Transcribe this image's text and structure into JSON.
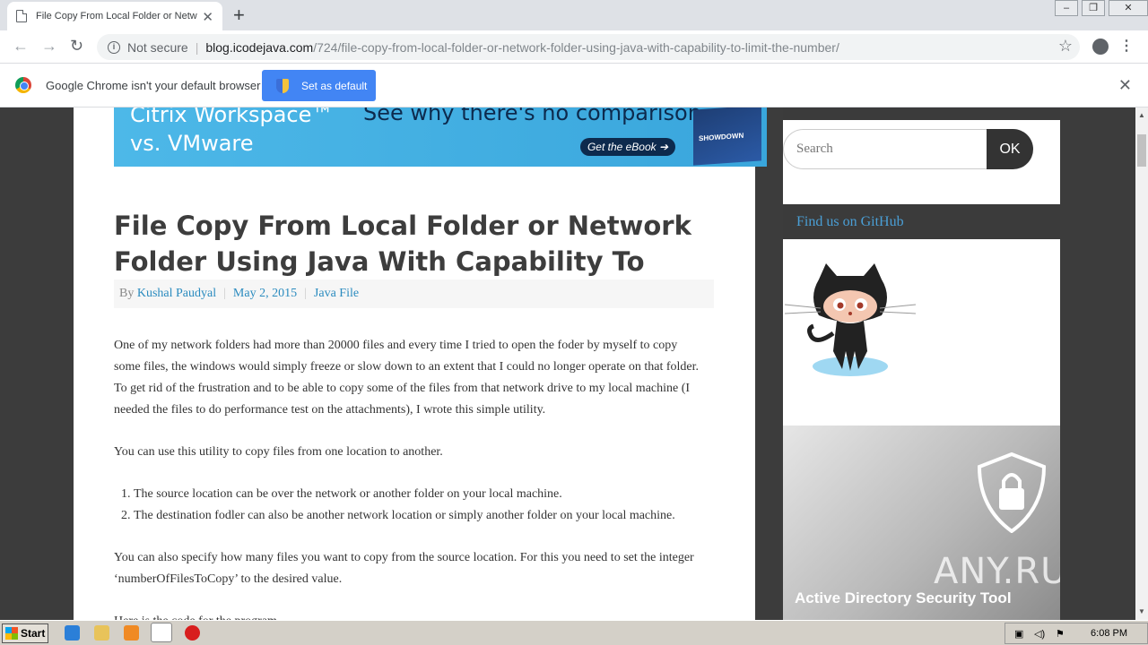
{
  "browser": {
    "tab_title": "File Copy From Local Folder or Network Folder",
    "security": "Not secure",
    "url_host": "blog.icodejava.com",
    "url_path": "/724/file-copy-from-local-folder-or-network-folder-using-java-with-capability-to-limit-the-number/"
  },
  "infobar": {
    "message": "Google Chrome isn't your default browser",
    "button": "Set as default"
  },
  "banner": {
    "left_line1": "Citrix Workspace™",
    "left_line2": "vs. VMware",
    "right": "See why there's no comparison.",
    "cta": "Get the eBook ➔",
    "book": "SHOWDOWN"
  },
  "post": {
    "title": "File Copy From Local Folder or Network Folder Using Java With Capability To Limit The Number",
    "by": "By",
    "author": "Kushal Paudyal",
    "date": "May 2, 2015",
    "category": "Java File",
    "p1": "One of my network folders had more than 20000 files and every time I tried to open the foder by myself to copy some files, the windows would simply freeze or slow down to an extent that I could no longer operate on that folder. To get rid of the frustration and to be able to copy some of the files from that network drive to my local machine (I needed the files to do performance test on the attachments), I wrote this simple utility.",
    "p2": "You can use this utility to copy files from one location to another.",
    "list": [
      "The source location can be over the network or another folder on your local machine.",
      "The destination fodler can also be another network location or simply another folder on your local machine."
    ],
    "p3": "You can also specify how many files you want to copy from the source location. For this you need to set the integer ‘numberOfFilesToCopy’ to the desired value.",
    "p4": "Here is the code for the program."
  },
  "sidebar": {
    "search_placeholder": "Search",
    "ok": "OK",
    "github_heading": "Find us on GitHub",
    "ad_title": "Active Directory Security Tool"
  },
  "watermark": "ANY.RUN",
  "taskbar": {
    "start": "Start",
    "clock": "6:08 PM"
  }
}
